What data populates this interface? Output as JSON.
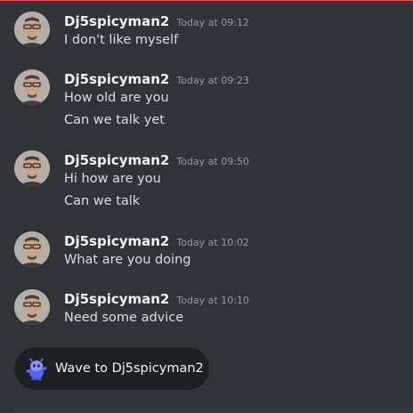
{
  "messages": [
    {
      "author": "Dj5spicyman2",
      "timestamp": "Today at 09:12",
      "lines": [
        "I don't like myself"
      ]
    },
    {
      "author": "Dj5spicyman2",
      "timestamp": "Today at 09:23",
      "lines": [
        "How old are you",
        "Can we talk yet"
      ]
    },
    {
      "author": "Dj5spicyman2",
      "timestamp": "Today at 09:50",
      "lines": [
        "Hi how are you",
        "Can we talk"
      ]
    },
    {
      "author": "Dj5spicyman2",
      "timestamp": "Today at 10:02",
      "lines": [
        "What are you doing"
      ]
    },
    {
      "author": "Dj5spicyman2",
      "timestamp": "Today at 10:10",
      "lines": [
        "Need some advice"
      ]
    }
  ],
  "wave": {
    "label": "Wave to Dj5spicyman2",
    "icon": "wumpus-wave-icon"
  },
  "colors": {
    "background": "#313338",
    "divider": "#e34b4f",
    "username": "#f2f3f5",
    "timestamp": "#949ba4",
    "message_text": "#dbdee1",
    "wave_button": "#1e1f22"
  }
}
